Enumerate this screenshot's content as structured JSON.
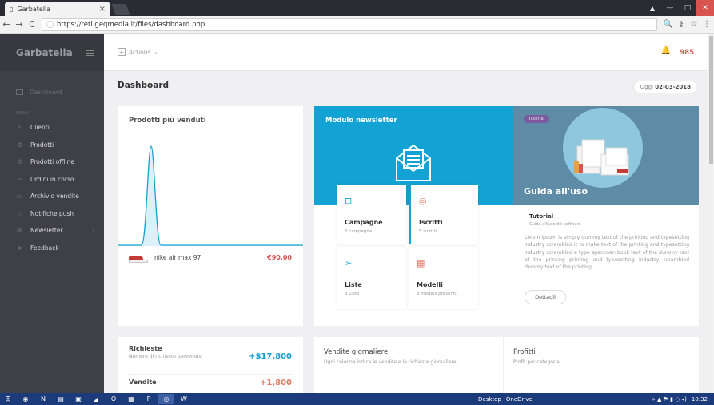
{
  "browser": {
    "tab_title": "Garbatella",
    "tab_close": "×",
    "url": "https://reti.geqmedia.it/files/dashboard.php",
    "nav_back": "←",
    "nav_forward": "→",
    "nav_reload": "C",
    "info": "ⓘ",
    "zoom": "🔍",
    "key": "⚷",
    "star": "☆",
    "menu": "⋮",
    "win_user": "▲",
    "win_min": "—",
    "win_max": "□",
    "win_close": "✕"
  },
  "sidebar": {
    "brand": "Garbatella",
    "dashboard": "Dashboard",
    "section": "MENU",
    "items": [
      {
        "label": "Clienti",
        "icon": "user-icon",
        "glyph": "♙"
      },
      {
        "label": "Prodotti",
        "icon": "gear-icon",
        "glyph": "⚙"
      },
      {
        "label": "Prodotti offline",
        "icon": "gear-icon",
        "glyph": "⚙"
      },
      {
        "label": "Ordini in corso",
        "icon": "list-icon",
        "glyph": "☰"
      },
      {
        "label": "Archivio vendite",
        "icon": "archive-icon",
        "glyph": "▭"
      },
      {
        "label": "Notifiche push",
        "icon": "phone-icon",
        "glyph": "▯"
      },
      {
        "label": "Newsletter",
        "icon": "mail-icon",
        "glyph": "✉"
      },
      {
        "label": "Feedback",
        "icon": "star-icon",
        "glyph": "★"
      }
    ],
    "newsletter_chevron": "›"
  },
  "topbar": {
    "actions_icon": "+",
    "actions": "Actions",
    "actions_caret": "⌄",
    "bell": "🔔",
    "points": "985"
  },
  "page": {
    "title": "Dashboard",
    "date_label": "Oggi",
    "date_value": "02-03-2018"
  },
  "best_sellers": {
    "title": "Prodotti più venduti",
    "product": "nike air max 97",
    "price": "€90.00",
    "chart_color": "#12a2d3"
  },
  "newsletter": {
    "title": "Modulo newsletter",
    "tiles": [
      {
        "name": "Campagne",
        "sub": "5 campagne",
        "icon": "campaign-icon",
        "glyph": "⊟"
      },
      {
        "name": "Iscritti",
        "sub": "5 iscritti",
        "icon": "subscribers-icon",
        "glyph": "◎"
      },
      {
        "name": "Liste",
        "sub": "3 Liste",
        "icon": "send-icon",
        "glyph": "➢"
      },
      {
        "name": "Modelli",
        "sub": "3 modelli presenti",
        "icon": "calendar-icon",
        "glyph": "▦"
      }
    ]
  },
  "tutorial": {
    "badge": "Tutorial",
    "heading": "Guida all'uso",
    "title": "Tutorial",
    "desc": "Guida all'uso del software",
    "body": "Lorem ipsum is simply dummy text of the printing and typesetting industry scrambled it to make text of the printing and typesetting industry scrambled a type specimen book text of the dummy text of the printing printing and typesetting industry scrambled dummy text of the printing.",
    "button": "Dettagli"
  },
  "stats": {
    "requests_title": "Richieste",
    "requests_sub": "Numero di richieste pervenute",
    "requests_value": "+$17,800",
    "sales_title": "Vendite",
    "sales_value": "+1,800",
    "daily_title": "Vendite giornaliere",
    "daily_sub": "Ogni colonna indica le vendite e le richieste giornaliere",
    "profits_title": "Profitti",
    "profits_sub": "Profit per categoria"
  },
  "taskbar": {
    "start": "⊞",
    "apps": [
      "◉",
      "N",
      "▤",
      "▣",
      "◢",
      "O",
      "▦",
      "P",
      "◎",
      "W"
    ],
    "desktop": "Desktop",
    "onedrive": "OneDrive",
    "tray_icons": "» ▲ ⚑ ▮ ◌ ◂)",
    "clock": "10:32"
  }
}
